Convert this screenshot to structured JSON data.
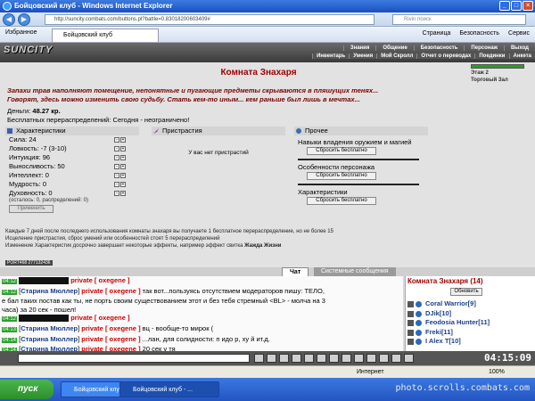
{
  "window": {
    "title": "Бойцовский клуб - Windows Internet Explorer",
    "url": "http://suncity.combats.com/buttons.pl?battle=0.83018200603409#",
    "search_placeholder": "Rivin поиск"
  },
  "favorites": {
    "favorites_label": "Избранное",
    "tab_label": "Бойцовский клуб",
    "tools": [
      "Страница",
      "Безопасность",
      "Сервис"
    ]
  },
  "game": {
    "logo": "SUNCITY",
    "top_menu": [
      "Знания",
      "Общение",
      "Безопасность",
      "Персонаж",
      "Выход"
    ],
    "sub_menu": [
      "Инвентарь",
      "Умения",
      "Мой Скролл",
      "Отчет о переводах",
      "Поединки",
      "Анкета"
    ],
    "right_info": [
      "Этаж 2",
      "Торговый Зал"
    ],
    "room_title": "Комната Знахаря",
    "room_desc": "Запахи трав наполняют помещение, непонятные и пугающие предметы скрываются в пляшущих тенях... Говорят, здесь можно изменить свою судьбу. Стать кем-то иным... кем раньше был лишь в мечтах...",
    "money_label": "Деньги:",
    "money_value": "48.27 кр.",
    "respec_text": "Бесплатных перераспределений: Сегодня - неограничено!",
    "panels": {
      "stats_title": "Характеристики",
      "stats": [
        {
          "name": "Сила",
          "value": "24"
        },
        {
          "name": "Ловкость",
          "value": "-7 (3-10)"
        },
        {
          "name": "Интуиция",
          "value": "96"
        },
        {
          "name": "Выносливость",
          "value": "50"
        },
        {
          "name": "Интеллект",
          "value": "0"
        },
        {
          "name": "Мудрость",
          "value": "0"
        },
        {
          "name": "Духовность",
          "value": "0"
        }
      ],
      "remaining": "(осталось: 0, распределений: 0)",
      "apply_button": "Применить",
      "pristrastia_title": "Пристрастия",
      "no_pristrastia": "У вас нет пристрастий",
      "other_title": "Прочее",
      "other_items": [
        {
          "label": "Навыки владения оружием и магией",
          "button": "Сбросить бесплатно"
        },
        {
          "label": "Особенности персонажа",
          "button": "Сбросить бесплатно"
        },
        {
          "label": "Характеристики",
          "button": "Сбросить бесплатно"
        }
      ]
    },
    "notice": [
      "Каждые 7 дней после последнего использования комнаты знахаря вы получаете 1 бесплатное перераспределение, но не более 15",
      "Исцеление пристрастия, сброс умений или особенностей стоят 5 перераспределений",
      "Изменение Характеристик досрочно завершает некоторые эффекты, например эффект свитка "
    ],
    "notice_bold": "Жажда Жизни",
    "ping": "PORT468 277132436"
  },
  "chat": {
    "tab_active": "Чат",
    "tab_other": "Системные сообщения",
    "messages": [
      {
        "time": "04:12",
        "sender": "",
        "to": "oxegene",
        "text": ""
      },
      {
        "time": "04:12",
        "sender": "Старина Мюллер",
        "to": "oxegene",
        "text": "так вот...пользуясь отсутствием модераторов пишу: ТЕЛО,"
      },
      {
        "time": "",
        "sender": "",
        "to": "",
        "text": "е бал таких постав как ты, не порть своим существованием этот и без тебя стремный <BL> - молча на 3"
      },
      {
        "time": "",
        "sender": "",
        "to": "",
        "text": "часа) за 20 сек - пошел!"
      },
      {
        "time": "04:12",
        "sender": "",
        "to": "oxegene",
        "text": ""
      },
      {
        "time": "04:13",
        "sender": "Старина Мюллер",
        "to": "oxegene",
        "text": "вц - вообще-то мирок ("
      },
      {
        "time": "04:14",
        "sender": "Старина Мюллер",
        "to": "oxegene",
        "text": "...лан, для солидности: п идо р, ху й ит.д."
      },
      {
        "time": "04:14",
        "sender": "Старина Мюллер",
        "to": "oxegene",
        "text": "20 сек у тя"
      },
      {
        "time": "04:14",
        "sender": "oxegene",
        "to": "Старина Мюллер",
        "text": "тебе к доктору нада"
      }
    ],
    "private_word": "private"
  },
  "roomlist": {
    "title": "Комната Знахаря (14)",
    "refresh": "Обновить",
    "users": [
      {
        "name": "Coral Warrior",
        "level": "[9]"
      },
      {
        "name": "DJik",
        "level": "[10]"
      },
      {
        "name": "Feodosia Hunter",
        "level": "[11]"
      },
      {
        "name": "Freki",
        "level": "[11]"
      },
      {
        "name": "I Alex T",
        "level": "[10]"
      }
    ]
  },
  "inputbar": {
    "clock": "04:15:09"
  },
  "ie_status": {
    "zone": "Интернет",
    "zoom": "100%"
  },
  "taskbar": {
    "start": "пуск",
    "tasks": [
      "Бойцовский клуб - ...",
      "Бойцовский клуб - ..."
    ],
    "watermark": "photo.scrolls.combats.com"
  }
}
